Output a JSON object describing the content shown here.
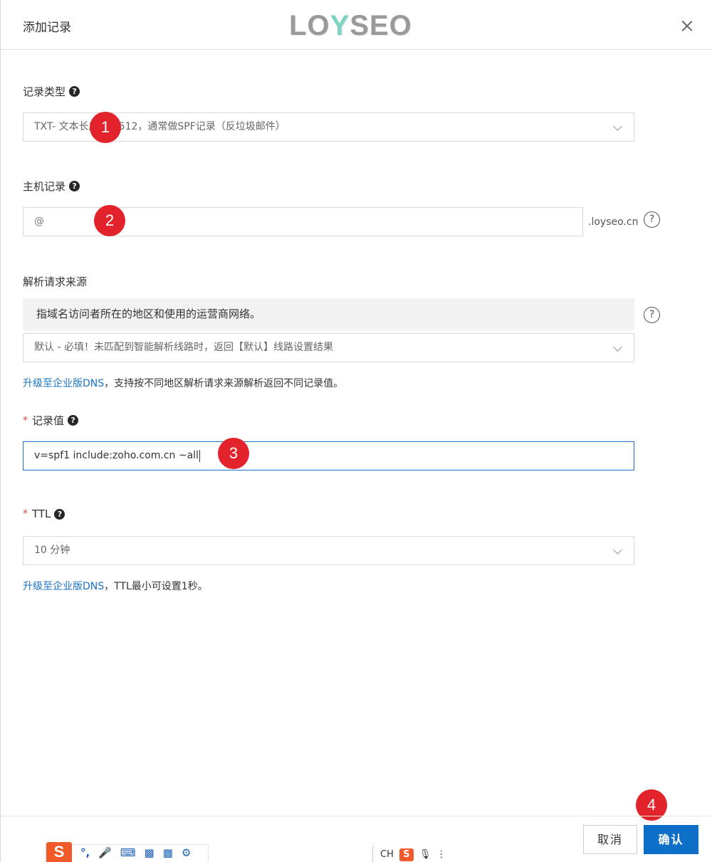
{
  "dialog": {
    "title": "添加记录",
    "watermark": {
      "part1": "LO",
      "part2": "Y",
      "part3": "SEO"
    }
  },
  "record_type": {
    "label": "记录类型",
    "help_glyph": "?",
    "value": "TXT- 文本长度限制512，通常做SPF记录（反垃圾邮件）"
  },
  "host_record": {
    "label": "主机记录",
    "help_glyph": "?",
    "value": "@",
    "suffix": ".loyseo.cn",
    "help_circle_glyph": "?"
  },
  "resolve_source": {
    "label": "解析请求来源",
    "tip": "指域名访问者所在的地区和使用的运营商网络。",
    "help_circle_glyph": "?",
    "value": "默认 - 必填！未匹配到智能解析线路时，返回【默认】线路设置结果",
    "hint_link": "升级至企业版DNS",
    "hint_text": "，支持按不同地区解析请求来源解析返回不同记录值。"
  },
  "record_value": {
    "required_mark": "*",
    "label": "记录值",
    "help_glyph": "?",
    "value": "v=spf1 include:zoho.com.cn ~all"
  },
  "ttl": {
    "required_mark": "*",
    "label": "TTL",
    "help_glyph": "?",
    "value": "10 分钟",
    "hint_link": "升级至企业版DNS",
    "hint_text": "，TTL最小可设置1秒。"
  },
  "annotations": [
    "1",
    "2",
    "3",
    "4"
  ],
  "footer": {
    "cancel_label": "取消",
    "ok_label": "确认"
  },
  "ime": {
    "logo": "S",
    "punct": "°,",
    "lang": "CH",
    "small_logo": "S"
  },
  "colors": {
    "primary": "#0d6fc7",
    "link": "#1a73c9",
    "badge": "#e3232c",
    "required": "#e64c3c"
  }
}
